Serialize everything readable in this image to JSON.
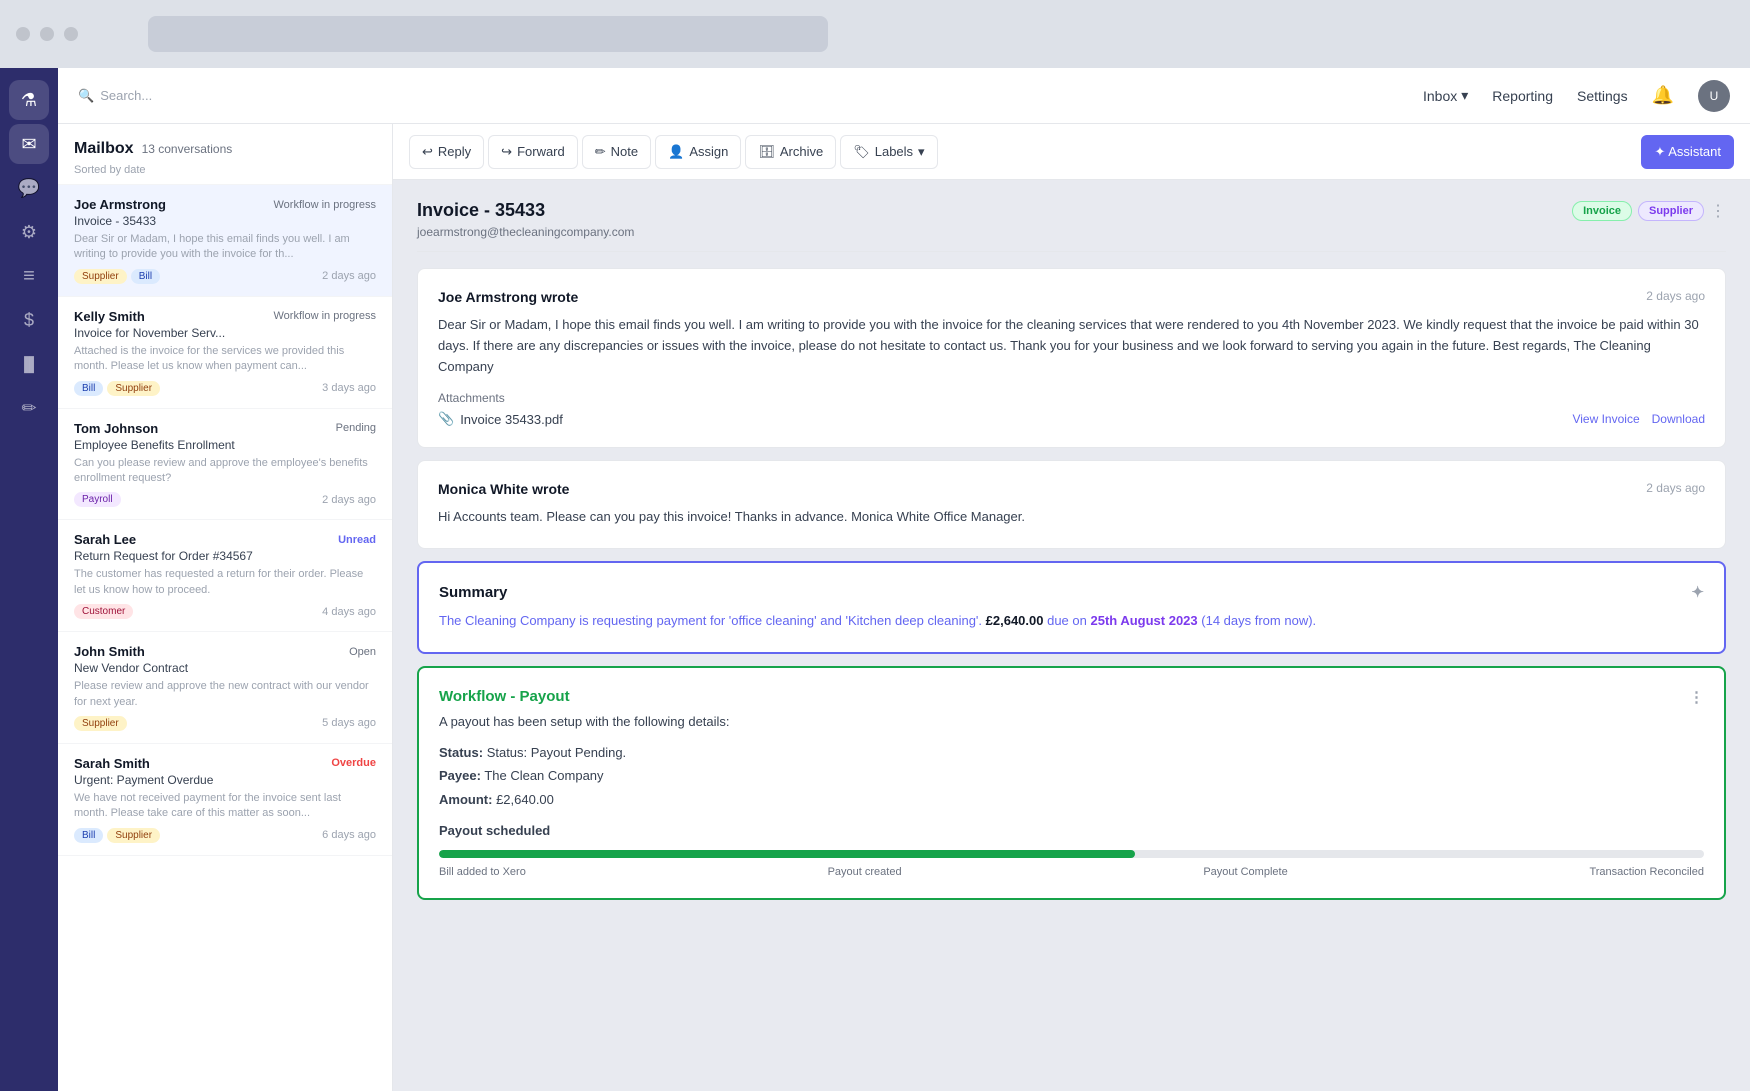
{
  "topbar": {
    "dots": [
      "dot1",
      "dot2",
      "dot3"
    ]
  },
  "sidebar": {
    "icons": [
      {
        "name": "flask-icon",
        "symbol": "⚗",
        "active": true
      },
      {
        "name": "inbox-icon",
        "symbol": "✉",
        "active": false
      },
      {
        "name": "chat-icon",
        "symbol": "💬",
        "active": false
      },
      {
        "name": "settings-icon",
        "symbol": "⚙",
        "active": false
      },
      {
        "name": "list-icon",
        "symbol": "≡",
        "active": false
      },
      {
        "name": "dollar-icon",
        "symbol": "$",
        "active": false
      },
      {
        "name": "chart-icon",
        "symbol": "📊",
        "active": false
      },
      {
        "name": "edit-icon",
        "symbol": "✏",
        "active": false
      }
    ]
  },
  "header": {
    "search_placeholder": "Search...",
    "nav": [
      {
        "label": "Inbox",
        "has_dropdown": true,
        "active": false
      },
      {
        "label": "Reporting",
        "active": false
      },
      {
        "label": "Settings",
        "active": false
      }
    ],
    "notification_icon": "bell-icon",
    "avatar_initials": "U"
  },
  "mailbox": {
    "title": "Mailbox",
    "conversation_count": "13 conversations",
    "sort_label": "Sorted by date",
    "conversations": [
      {
        "name": "Joe Armstrong",
        "subject": "Invoice - 35433",
        "status": "Workflow in progress",
        "status_type": "workflow",
        "preview": "Dear Sir or Madam, I hope this email finds you well. I am writing to provide you with the invoice for th...",
        "tags": [
          "Supplier",
          "Bill"
        ],
        "tag_types": [
          "supplier",
          "bill"
        ],
        "time": "2 days ago",
        "active": true
      },
      {
        "name": "Kelly Smith",
        "subject": "Invoice for November Serv...",
        "status": "Workflow in progress",
        "status_type": "workflow",
        "preview": "Attached is the invoice for the services we provided this month. Please let us know when payment can...",
        "tags": [
          "Bill",
          "Supplier"
        ],
        "tag_types": [
          "bill",
          "supplier"
        ],
        "time": "3 days ago",
        "active": false
      },
      {
        "name": "Tom Johnson",
        "subject": "Employee Benefits Enrollment",
        "status": "Pending",
        "status_type": "pending",
        "preview": "Can you please review and approve the employee's benefits enrollment request?",
        "tags": [
          "Payroll"
        ],
        "tag_types": [
          "payroll"
        ],
        "time": "2 days ago",
        "active": false
      },
      {
        "name": "Sarah Lee",
        "subject": "Return Request for Order #34567",
        "status": "Unread",
        "status_type": "unread",
        "preview": "The customer has requested a return for their order. Please let us know how to proceed.",
        "tags": [
          "Customer"
        ],
        "tag_types": [
          "customer"
        ],
        "time": "4 days ago",
        "active": false
      },
      {
        "name": "John Smith",
        "subject": "New Vendor Contract",
        "status": "Open",
        "status_type": "open",
        "preview": "Please review and approve the new contract with our vendor for next year.",
        "tags": [
          "Supplier"
        ],
        "tag_types": [
          "supplier"
        ],
        "time": "5 days ago",
        "active": false
      },
      {
        "name": "Sarah Smith",
        "subject": "Urgent: Payment Overdue",
        "status": "Overdue",
        "status_type": "overdue",
        "preview": "We have not received payment for the invoice sent last month. Please take care of this matter as soon...",
        "tags": [
          "Bill",
          "Supplier"
        ],
        "tag_types": [
          "bill",
          "supplier"
        ],
        "time": "6 days ago",
        "active": false
      }
    ]
  },
  "toolbar": {
    "reply_label": "Reply",
    "forward_label": "Forward",
    "note_label": "Note",
    "assign_label": "Assign",
    "archive_label": "Archive",
    "labels_label": "Labels",
    "assistant_label": "✦ Assistant"
  },
  "email": {
    "title": "Invoice - 35433",
    "from": "joearmstrong@thecleaningcompany.com",
    "badge_invoice": "Invoice",
    "badge_supplier": "Supplier",
    "messages": [
      {
        "author": "Joe Armstrong",
        "verb": "wrote",
        "time": "2 days ago",
        "body": "Dear Sir or Madam, I hope this email finds you well. I am writing to provide you with the invoice for the cleaning services that were rendered to you 4th November 2023. We kindly request that the invoice be paid within 30 days. If there are any discrepancies or issues with the invoice, please do not hesitate to contact us. Thank you for your business and we look forward to serving you again in the future. Best regards, The Cleaning Company",
        "has_attachment": true,
        "attachment_name": "Invoice 35433.pdf",
        "attachment_actions": [
          "View Invoice",
          "Download"
        ]
      },
      {
        "author": "Monica White",
        "verb": "wrote",
        "time": "2 days ago",
        "body": "Hi Accounts team. Please can you pay this invoice! Thanks in advance. Monica White Office Manager.",
        "has_attachment": false
      }
    ],
    "summary": {
      "title": "Summary",
      "text_before": "The Cleaning Company is requesting payment for 'office cleaning' and 'Kitchen deep cleaning'. ",
      "amount": "£2,640.00",
      "text_middle": " due on ",
      "date": "25th August 2023",
      "text_after": " (14 days from now)."
    },
    "workflow": {
      "title": "Workflow - Payout",
      "setup_text": "A payout has been setup with the following details:",
      "status_label": "Status:",
      "status_value": "Status: Payout Pending.",
      "payee_label": "Payee:",
      "payee_value": "The Clean Company",
      "amount_label": "Amount:",
      "amount_value": "£2,640.00",
      "scheduled_label": "Payout scheduled",
      "progress_percent": 55,
      "progress_steps": [
        {
          "label": "Bill added to Xero"
        },
        {
          "label": "Payout created"
        },
        {
          "label": "Payout Complete"
        },
        {
          "label": "Transaction Reconciled"
        }
      ]
    }
  }
}
